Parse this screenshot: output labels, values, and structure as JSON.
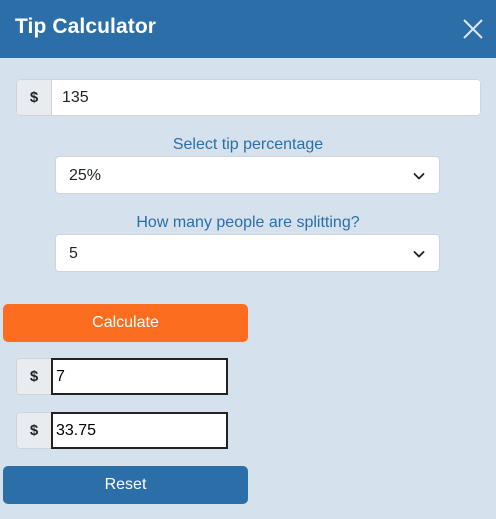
{
  "header": {
    "title": "Tip Calculator",
    "close_icon": "close-icon"
  },
  "bill": {
    "currency": "$",
    "value": "135"
  },
  "tip": {
    "label": "Select tip percentage",
    "selected": "25%"
  },
  "people": {
    "label": "How many people are splitting?",
    "selected": "5"
  },
  "buttons": {
    "calculate": "Calculate",
    "reset": "Reset"
  },
  "results": {
    "tip_per_person": {
      "currency": "$",
      "value": "7"
    },
    "total": {
      "currency": "$",
      "value": "33.75"
    }
  },
  "colors": {
    "header_bg": "#2c6ea7",
    "page_bg": "#d5e1ed",
    "accent_orange": "#fd6d20",
    "label_blue": "#2c6ea7"
  }
}
